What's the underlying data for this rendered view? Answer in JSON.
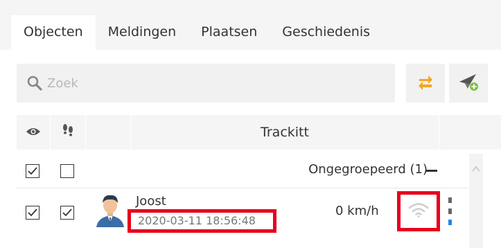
{
  "tabs": [
    {
      "label": "Objecten",
      "active": true
    },
    {
      "label": "Meldingen",
      "active": false
    },
    {
      "label": "Plaatsen",
      "active": false
    },
    {
      "label": "Geschiedenis",
      "active": false
    }
  ],
  "search": {
    "placeholder": "Zoek",
    "value": ""
  },
  "toolbar": {
    "refresh_icon": "refresh-arrows-icon",
    "add_icon": "send-plus-icon"
  },
  "table": {
    "header": {
      "visibility_icon": "eye-icon",
      "tracks_icon": "footprints-icon",
      "title": "Trackitt"
    },
    "group": {
      "label": "Ongegroepeerd (1)",
      "visible_checked": true,
      "tracks_checked": false
    },
    "items": [
      {
        "name": "Joost",
        "timestamp": "2020-03-11 18:56:48",
        "speed": "0 km/h",
        "visible_checked": true,
        "tracks_checked": true,
        "signal_icon": "wifi-icon",
        "avatar_icon": "person-avatar-icon"
      }
    ]
  },
  "colors": {
    "highlight": "#e8001c",
    "accent_orange": "#f5a623",
    "accent_green": "#7ec242",
    "accent_blue": "#1e88e5"
  }
}
